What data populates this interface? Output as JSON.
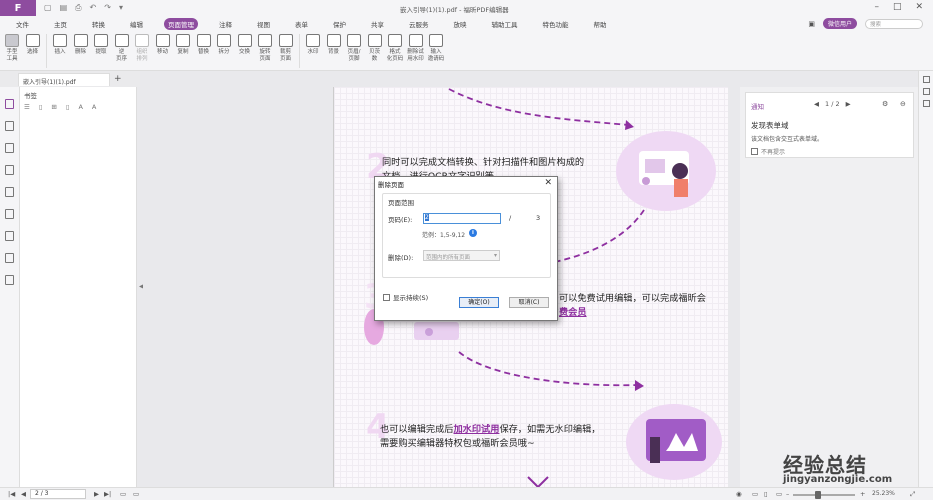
{
  "titlebar": {
    "title": "嵌入引导(1)(1).pdf - 福昕PDF编辑器",
    "logo": "F"
  },
  "menus": [
    "文件",
    "主页",
    "转换",
    "编辑",
    "页面管理",
    "注释",
    "视图",
    "表单",
    "保护",
    "共享",
    "云服务",
    "放映",
    "辅助工具",
    "特色功能",
    "帮助"
  ],
  "menu_active": "页面管理",
  "user_button": "微信用户",
  "search_placeholder": "搜索",
  "tools": [
    {
      "label": "手型\n工具",
      "name": "hand-tool",
      "hand": true
    },
    {
      "label": "选择",
      "name": "select-tool"
    },
    {
      "sep": true
    },
    {
      "label": "插入",
      "name": "insert-tool"
    },
    {
      "label": "删除",
      "name": "delete-tool"
    },
    {
      "label": "提取",
      "name": "extract-tool"
    },
    {
      "label": "逆\n页序",
      "name": "reverse-tool"
    },
    {
      "label": "组织\n排列",
      "name": "organize-tool",
      "disabled": true
    },
    {
      "label": "移动",
      "name": "move-tool"
    },
    {
      "label": "复制",
      "name": "copy-tool"
    },
    {
      "label": "替换",
      "name": "replace-tool"
    },
    {
      "label": "拆分",
      "name": "split-tool"
    },
    {
      "label": "交换",
      "name": "swap-tool"
    },
    {
      "label": "旋转\n页面",
      "name": "rotate-tool"
    },
    {
      "label": "裁剪\n页面",
      "name": "crop-tool"
    },
    {
      "sep": true
    },
    {
      "label": "水印",
      "name": "watermark-tool"
    },
    {
      "label": "背景",
      "name": "background-tool"
    },
    {
      "label": "页眉/\n页脚",
      "name": "header-footer-tool"
    },
    {
      "label": "贝茨\n数",
      "name": "bates-tool"
    },
    {
      "label": "格式\n化页码",
      "name": "format-pages-tool"
    },
    {
      "label": "删除试\n用水印",
      "name": "remove-trial-tool"
    },
    {
      "label": "输入\n邀请码",
      "name": "invite-code-tool"
    }
  ],
  "doc_tab": "嵌入引导(1)(1).pdf",
  "bookmarks_title": "书签",
  "page": {
    "text1": "同时可以完成文档转换、针对扫描件和图片构成的",
    "text2": "文档，进行OCR文字识别等",
    "text3_prefix": "可以免费试用编辑，可以完成福昕会",
    "text3_link": "费会员",
    "text4_prefix": "也可以编辑完成后",
    "text4_link": "加水印试用",
    "text4_suffix": "保存，如需无水印编辑，",
    "text5": "需要购买编辑器特权包或福昕会员哦~",
    "num4": "4"
  },
  "dialog": {
    "title": "删除页面",
    "group": "页面范围",
    "pages_label": "页码(E):",
    "pages_value": "2",
    "slash": "/",
    "total": "3",
    "range_hint": "范例：1,5-9,12",
    "delete_label": "删除(D):",
    "delete_value": "范围内的所有页面",
    "no_show": "显示持续(S)",
    "ok": "确定(O)",
    "cancel": "取消(C)"
  },
  "notice": {
    "title": "通知",
    "nav": "1 / 2",
    "heading": "发现表单域",
    "body": "该文档包含交互式表单域。",
    "dont_show": "不再提示"
  },
  "status": {
    "page": "2 / 3",
    "zoom": "25.23%"
  },
  "watermark": {
    "text": "经验总结",
    "url": "jingyanzongjie.com"
  }
}
